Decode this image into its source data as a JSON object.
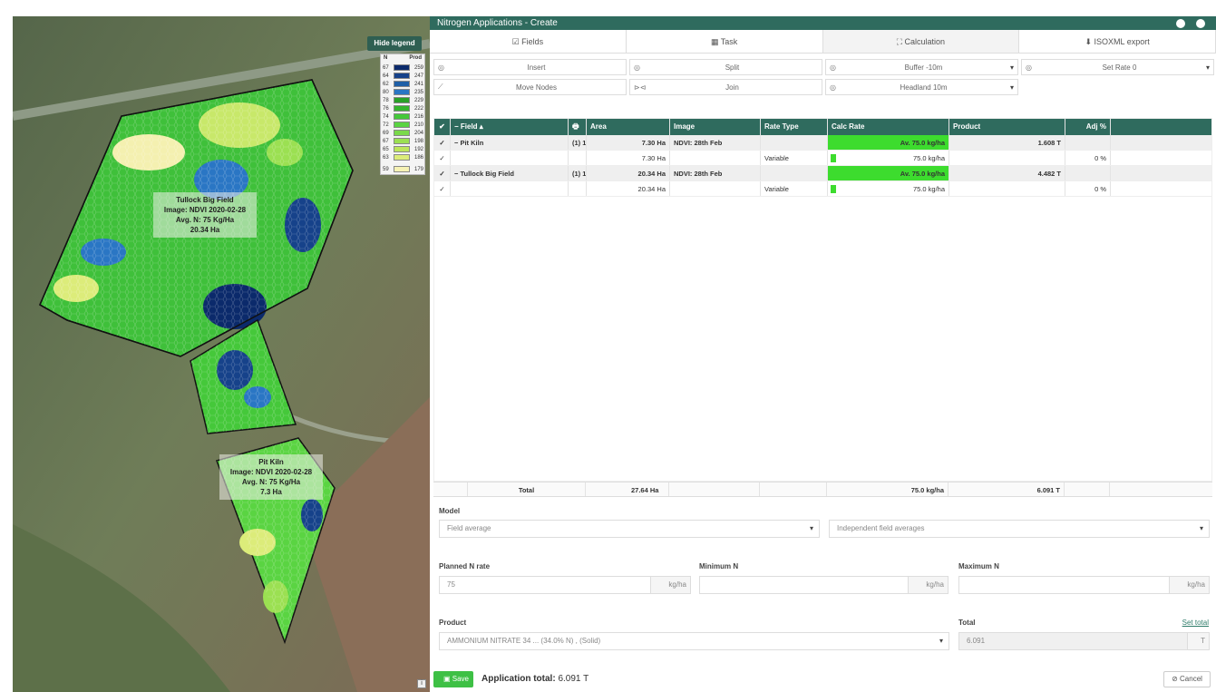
{
  "map": {
    "hide_legend": "Hide legend",
    "legend": {
      "head_n": "N",
      "head_prod": "Prod",
      "rows": [
        {
          "n": "67",
          "p": "259",
          "c": "#0b2a6b"
        },
        {
          "n": "64",
          "p": "247",
          "c": "#16428a"
        },
        {
          "n": "62",
          "p": "241",
          "c": "#1f5fa6"
        },
        {
          "n": "80",
          "p": "235",
          "c": "#2a76c4"
        },
        {
          "n": "78",
          "p": "229",
          "c": "#2aa028"
        },
        {
          "n": "76",
          "p": "222",
          "c": "#36b52e"
        },
        {
          "n": "74",
          "p": "216",
          "c": "#45c83a"
        },
        {
          "n": "72",
          "p": "210",
          "c": "#5ad442"
        },
        {
          "n": "69",
          "p": "204",
          "c": "#7ad94a"
        },
        {
          "n": "67",
          "p": "198",
          "c": "#9be052"
        },
        {
          "n": "65",
          "p": "192",
          "c": "#bde65c"
        },
        {
          "n": "63",
          "p": "186",
          "c": "#dcec7a"
        },
        {
          "n": "59",
          "p": "179",
          "c": "#f6f2b4"
        }
      ]
    },
    "fields": [
      {
        "name": "Tullock Big Field",
        "image": "Image: NDVI 2020-02-28",
        "avg": "Avg. N: 75 Kg/Ha",
        "area": "20.34 Ha"
      },
      {
        "name": "Pit Kiln",
        "image": "Image: NDVI 2020-02-28",
        "avg": "Avg. N: 75 Kg/Ha",
        "area": "7.3 Ha"
      }
    ],
    "corner": "i"
  },
  "dialog": {
    "title": "Nitrogen Applications - Create",
    "tabs": [
      {
        "icon": "☑",
        "label": "Fields"
      },
      {
        "icon": "▦",
        "label": "Task"
      },
      {
        "icon": "⛶",
        "label": "Calculation"
      },
      {
        "icon": "⬇",
        "label": "ISOXML export"
      }
    ],
    "tools": [
      {
        "icon": "◎",
        "label": "Insert"
      },
      {
        "icon": "◎",
        "label": "Split"
      },
      {
        "icon": "◎",
        "label": "Buffer -10m",
        "dd": "▾"
      },
      {
        "icon": "◎",
        "label": "Set Rate 0",
        "dd": "▾"
      },
      {
        "icon": "⟋",
        "label": "Move Nodes"
      },
      {
        "icon": "⊳⊲",
        "label": "Join"
      },
      {
        "icon": "◎",
        "label": "Headland 10m",
        "dd": "▾"
      }
    ],
    "grid": {
      "headers": [
        "✔",
        "− Field ▴",
        "🖶",
        "Area",
        "Image",
        "Rate Type",
        "Calc Rate",
        "Product",
        "Adj %"
      ],
      "rows": [
        {
          "chk": "✓",
          "field": "− Pit Kiln",
          "cnt": "(1)  1",
          "area": "7.30 Ha",
          "image": "NDVI: 28th Feb",
          "type": "",
          "rate": "Av. 75.0 kg/ha",
          "product": "1.608 T",
          "adj": "",
          "parent": true
        },
        {
          "chk": "✓",
          "field": "",
          "cnt": "",
          "area": "7.30 Ha",
          "image": "",
          "type": "Variable",
          "rate": "75.0 kg/ha",
          "product": "",
          "adj": "0 %",
          "parent": false
        },
        {
          "chk": "✓",
          "field": "− Tullock Big Field",
          "cnt": "(1)  1",
          "area": "20.34 Ha",
          "image": "NDVI: 28th Feb",
          "type": "",
          "rate": "Av. 75.0 kg/ha",
          "product": "4.482 T",
          "adj": "",
          "parent": true
        },
        {
          "chk": "✓",
          "field": "",
          "cnt": "",
          "area": "20.34 Ha",
          "image": "",
          "type": "Variable",
          "rate": "75.0 kg/ha",
          "product": "",
          "adj": "0 %",
          "parent": false
        }
      ],
      "total": {
        "label": "Total",
        "area": "27.64 Ha",
        "rate": "75.0 kg/ha",
        "product": "6.091 T"
      }
    },
    "model": {
      "label": "Model",
      "left": "Field average",
      "right": "Independent field averages"
    },
    "planned": {
      "label": "Planned N rate",
      "value": "75",
      "unit": "kg/ha"
    },
    "minimum": {
      "label": "Minimum N",
      "value": "",
      "unit": "kg/ha"
    },
    "maximum": {
      "label": "Maximum N",
      "value": "",
      "unit": "kg/ha"
    },
    "product": {
      "label": "Product",
      "value": "AMMONIUM NITRATE 34 ... (34.0% N) , (Solid)"
    },
    "total": {
      "label": "Total",
      "link": "Set total",
      "value": "6.091",
      "unit": "T"
    },
    "save": "Save",
    "app_total_label": "Application total:",
    "app_total_value": "6.091 T",
    "cancel": "Cancel"
  },
  "colors": {
    "accent": "#2f6b5e",
    "green": "#3ec045"
  }
}
